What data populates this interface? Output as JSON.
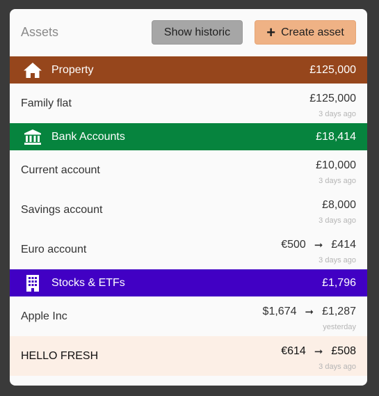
{
  "header": {
    "title": "Assets",
    "show_historic_label": "Show historic",
    "create_asset_label": "Create asset"
  },
  "groups": [
    {
      "name": "Property",
      "total": "£125,000",
      "color": "#96461c",
      "icon": "house-icon",
      "rows": [
        {
          "name": "Family flat",
          "value": "£125,000",
          "time": "3 days ago"
        }
      ]
    },
    {
      "name": "Bank Accounts",
      "total": "£18,414",
      "color": "#06843e",
      "icon": "bank-icon",
      "rows": [
        {
          "name": "Current account",
          "value": "£10,000",
          "time": "3 days ago"
        },
        {
          "name": "Savings account",
          "value": "£8,000",
          "time": "3 days ago"
        },
        {
          "name": "Euro account",
          "original": "€500",
          "value": "£414",
          "time": "3 days ago"
        }
      ]
    },
    {
      "name": "Stocks & ETFs",
      "total": "£1,796",
      "color": "#4100c4",
      "icon": "office-building-icon",
      "rows": [
        {
          "name": "Apple Inc",
          "original": "$1,674",
          "value": "£1,287",
          "time": "yesterday"
        },
        {
          "name": "HELLO FRESH",
          "original": "€614",
          "value": "£508",
          "time": "3 days ago"
        }
      ]
    }
  ]
}
